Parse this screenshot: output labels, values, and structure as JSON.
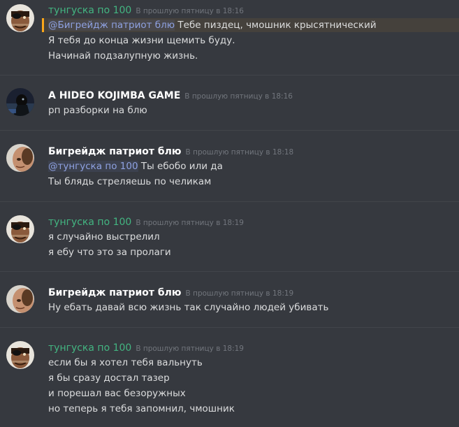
{
  "messages": [
    {
      "username": "тунгуска по 100",
      "timestamp": "В прошлую пятницу в 18:16",
      "avatar": "eyepatch-man-avatar",
      "lines": [
        {
          "mention": "@Бигрейдж патриот блю",
          "text": " Тебе пиздец, чмошник крысятнический"
        },
        {
          "text": "Я тебя до конца жизни щемить буду."
        },
        {
          "text": "Начинай подзалупную жизнь."
        }
      ]
    },
    {
      "username": "A HIDEO KOJIMBA GAME",
      "timestamp": "В прошлую пятницу в 18:16",
      "avatar": "dark-figure-avatar",
      "lines": [
        {
          "text": "рп разборки на блю"
        }
      ]
    },
    {
      "username": "Бигрейдж патриот блю",
      "timestamp": "В прошлую пятницу в 18:18",
      "avatar": "face-avatar",
      "lines": [
        {
          "mention": "@тунгуска по 100",
          "text": " Ты ебобо или да"
        },
        {
          "text": "Ты блядь стреляешь по челикам"
        }
      ]
    },
    {
      "username": "тунгуска по 100",
      "timestamp": "В прошлую пятницу в 18:19",
      "avatar": "eyepatch-man-avatar",
      "lines": [
        {
          "text": "я случайно выстрелил"
        },
        {
          "text": "я ебу что это за пролаги"
        }
      ]
    },
    {
      "username": "Бигрейдж патриот блю",
      "timestamp": "В прошлую пятницу в 18:19",
      "avatar": "face-avatar",
      "lines": [
        {
          "text": "Ну ебать давай всю жизнь так случайно людей убивать"
        }
      ]
    },
    {
      "username": "тунгуска по 100",
      "timestamp": "В прошлую пятницу в 18:19",
      "avatar": "eyepatch-man-avatar",
      "lines": [
        {
          "text": "если бы я хотел тебя вальнуть"
        },
        {
          "text": "я бы сразу достал тазер"
        },
        {
          "text": "и порешал вас безоружных"
        },
        {
          "text": "но теперь я тебя запомнил, чмошник"
        }
      ]
    }
  ],
  "colors": {
    "background": "#36393f",
    "username_green": "#43b581",
    "username_white": "#ffffff",
    "timestamp": "#72767d",
    "text": "#dcddde",
    "mention": "#8ea1e1",
    "mention_highlight": "#faa61a"
  }
}
